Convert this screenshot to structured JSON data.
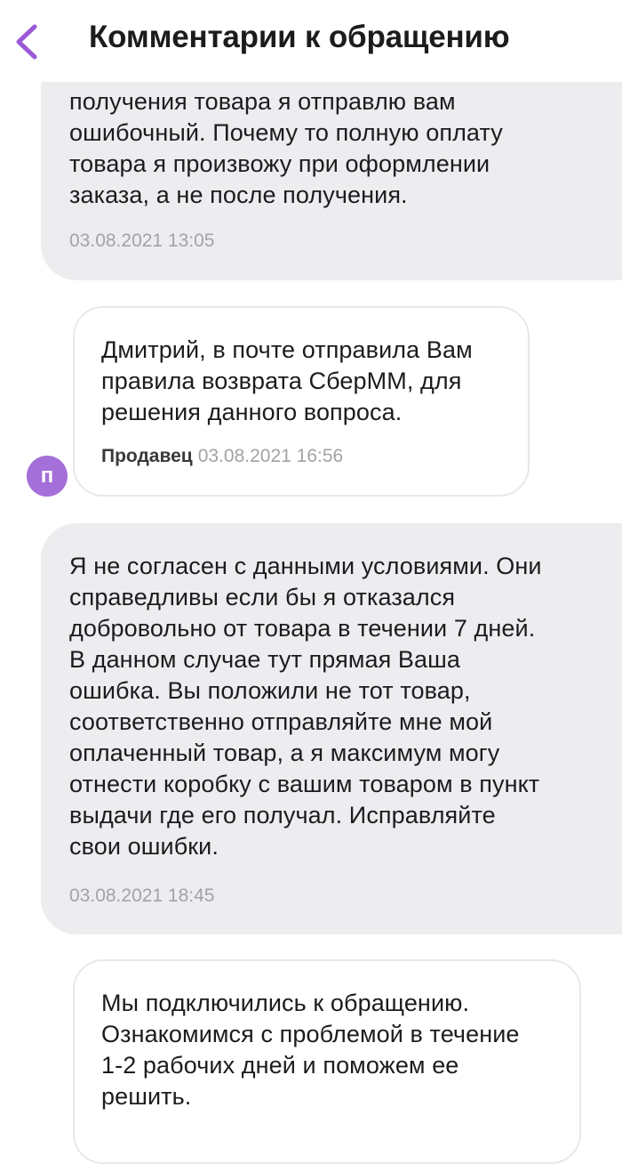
{
  "header": {
    "title": "Комментарии к обращению"
  },
  "messages": [
    {
      "text": "получения товара я отправлю вам\nошибочный. Почему то полную оплату\nтовара я произвожу при оформлении\nзаказа, а не после получения.",
      "timestamp": "03.08.2021 13:05"
    },
    {
      "text": "Дмитрий, в почте отправила Вам\nправила возврата СберММ, для\nрешения данного вопроса.",
      "author": "Продавец",
      "timestamp": "03.08.2021 16:56",
      "avatar_letter": "п"
    },
    {
      "text": "Я не согласен с данными условиями. Они\nсправедливы если бы я отказался\nдобровольно от товара в течении 7 дней.\nВ данном случае тут прямая Ваша\nошибка. Вы положили не тот товар,\nсоответственно отправляйте мне мой\nоплаченный товар, а я максимум могу\nотнести коробку с вашим товаром в пункт\nвыдачи где его получал. Исправляйте\nсвои ошибки.",
      "timestamp": "03.08.2021 18:45"
    },
    {
      "text": "Мы подключились к обращению.\nОзнакомимся с проблемой в течение\n1-2 рабочих дней и поможем ее\nрешить."
    }
  ],
  "colors": {
    "accent": "#9b59d6",
    "user_bubble": "#ededf0",
    "avatar": "#a46fd8",
    "timestamp": "#a2a2a8"
  },
  "icons": {
    "back": "chevron-left-icon"
  }
}
